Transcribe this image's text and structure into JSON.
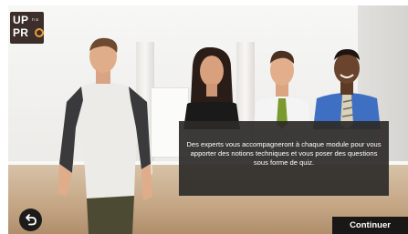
{
  "logo": {
    "line1": "UP",
    "line2": "PR",
    "superscript": "n a"
  },
  "dialog": {
    "text": "Des experts vous accompagneront à chaque module pour vous apporter des notions techniques et vous poser des questions sous forme de quiz."
  },
  "nav": {
    "back_icon": "return-arrow-icon",
    "continue_label": "Continuer"
  },
  "colors": {
    "logo_bg": "#3c2e2a",
    "logo_accent": "#f2a034",
    "dialog_bg": "#2c2a28",
    "button_bg": "#1a1817"
  }
}
